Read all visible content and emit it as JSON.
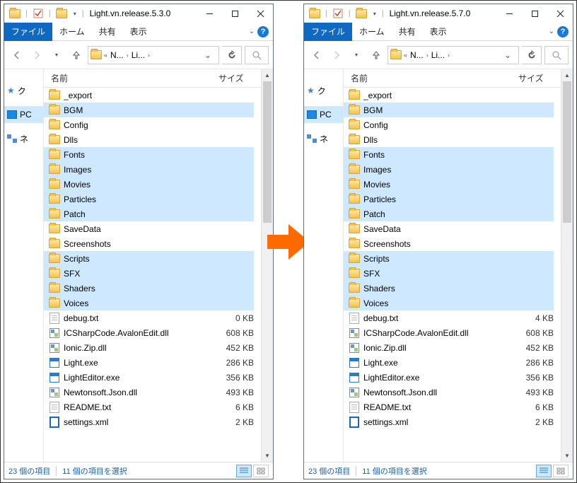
{
  "windows": [
    {
      "title": "Light.vn.release.5.3.0"
    },
    {
      "title": "Light.vn.release.5.7.0"
    }
  ],
  "ribbon": {
    "file": "ファイル",
    "home": "ホーム",
    "share": "共有",
    "view": "表示"
  },
  "breadcrumb": {
    "seg1": "N...",
    "seg2": "Li..."
  },
  "nav": {
    "quick": "ク",
    "pc": "PC",
    "net": "ネ"
  },
  "columns": {
    "name": "名前",
    "size": "サイズ"
  },
  "files_left": [
    {
      "name": "_export",
      "type": "folder",
      "sel": false,
      "size": ""
    },
    {
      "name": "BGM",
      "type": "folder",
      "sel": true,
      "size": ""
    },
    {
      "name": "Config",
      "type": "folder",
      "sel": false,
      "size": ""
    },
    {
      "name": "Dlls",
      "type": "folder",
      "sel": false,
      "size": ""
    },
    {
      "name": "Fonts",
      "type": "folder",
      "sel": true,
      "size": ""
    },
    {
      "name": "Images",
      "type": "folder",
      "sel": true,
      "size": ""
    },
    {
      "name": "Movies",
      "type": "folder",
      "sel": true,
      "size": ""
    },
    {
      "name": "Particles",
      "type": "folder",
      "sel": true,
      "size": ""
    },
    {
      "name": "Patch",
      "type": "folder",
      "sel": true,
      "size": ""
    },
    {
      "name": "SaveData",
      "type": "folder",
      "sel": false,
      "size": ""
    },
    {
      "name": "Screenshots",
      "type": "folder",
      "sel": false,
      "size": ""
    },
    {
      "name": "Scripts",
      "type": "folder",
      "sel": true,
      "size": ""
    },
    {
      "name": "SFX",
      "type": "folder",
      "sel": true,
      "size": ""
    },
    {
      "name": "Shaders",
      "type": "folder",
      "sel": true,
      "size": ""
    },
    {
      "name": "Voices",
      "type": "folder",
      "sel": true,
      "size": ""
    },
    {
      "name": "debug.txt",
      "type": "txt",
      "sel": false,
      "size": "0 KB"
    },
    {
      "name": "ICSharpCode.AvalonEdit.dll",
      "type": "dll",
      "sel": false,
      "size": "608 KB"
    },
    {
      "name": "Ionic.Zip.dll",
      "type": "dll",
      "sel": false,
      "size": "452 KB"
    },
    {
      "name": "Light.exe",
      "type": "exe",
      "sel": false,
      "size": "286 KB"
    },
    {
      "name": "LightEditor.exe",
      "type": "exe",
      "sel": false,
      "size": "356 KB"
    },
    {
      "name": "Newtonsoft.Json.dll",
      "type": "dll",
      "sel": false,
      "size": "493 KB"
    },
    {
      "name": "README.txt",
      "type": "txt",
      "sel": false,
      "size": "6 KB"
    },
    {
      "name": "settings.xml",
      "type": "xml",
      "sel": false,
      "size": "2 KB"
    }
  ],
  "files_right": [
    {
      "name": "_export",
      "type": "folder",
      "sel": false,
      "size": ""
    },
    {
      "name": "BGM",
      "type": "folder",
      "sel": true,
      "size": ""
    },
    {
      "name": "Config",
      "type": "folder",
      "sel": false,
      "size": ""
    },
    {
      "name": "Dlls",
      "type": "folder",
      "sel": false,
      "size": ""
    },
    {
      "name": "Fonts",
      "type": "folder",
      "sel": true,
      "size": ""
    },
    {
      "name": "Images",
      "type": "folder",
      "sel": true,
      "size": ""
    },
    {
      "name": "Movies",
      "type": "folder",
      "sel": true,
      "size": ""
    },
    {
      "name": "Particles",
      "type": "folder",
      "sel": true,
      "size": ""
    },
    {
      "name": "Patch",
      "type": "folder",
      "sel": true,
      "size": ""
    },
    {
      "name": "SaveData",
      "type": "folder",
      "sel": false,
      "size": ""
    },
    {
      "name": "Screenshots",
      "type": "folder",
      "sel": false,
      "size": ""
    },
    {
      "name": "Scripts",
      "type": "folder",
      "sel": true,
      "size": ""
    },
    {
      "name": "SFX",
      "type": "folder",
      "sel": true,
      "size": ""
    },
    {
      "name": "Shaders",
      "type": "folder",
      "sel": true,
      "size": ""
    },
    {
      "name": "Voices",
      "type": "folder",
      "sel": true,
      "size": ""
    },
    {
      "name": "debug.txt",
      "type": "txt",
      "sel": false,
      "size": "4 KB"
    },
    {
      "name": "ICSharpCode.AvalonEdit.dll",
      "type": "dll",
      "sel": false,
      "size": "608 KB"
    },
    {
      "name": "Ionic.Zip.dll",
      "type": "dll",
      "sel": false,
      "size": "452 KB"
    },
    {
      "name": "Light.exe",
      "type": "exe",
      "sel": false,
      "size": "286 KB"
    },
    {
      "name": "LightEditor.exe",
      "type": "exe",
      "sel": false,
      "size": "356 KB"
    },
    {
      "name": "Newtonsoft.Json.dll",
      "type": "dll",
      "sel": false,
      "size": "493 KB"
    },
    {
      "name": "README.txt",
      "type": "txt",
      "sel": false,
      "size": "6 KB"
    },
    {
      "name": "settings.xml",
      "type": "xml",
      "sel": false,
      "size": "2 KB"
    }
  ],
  "status": {
    "count": "23 個の項目",
    "sel": "11 個の項目を選択"
  }
}
